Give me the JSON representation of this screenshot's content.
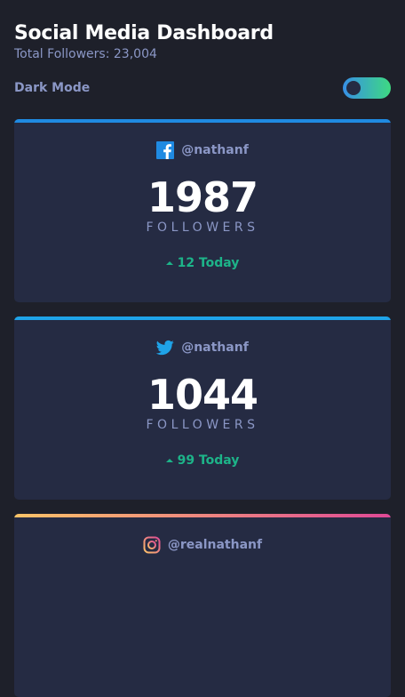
{
  "header": {
    "title": "Social Media Dashboard",
    "subtitle": "Total Followers: 23,004"
  },
  "theme_toggle": {
    "label": "Dark Mode",
    "enabled": true
  },
  "cards": [
    {
      "platform": "facebook",
      "icon": "facebook-icon",
      "handle": "@nathanf",
      "count": "1987",
      "unit": "FOLLOWERS",
      "delta": "12 Today",
      "accent": "#1f8ae2"
    },
    {
      "platform": "twitter",
      "icon": "twitter-icon",
      "handle": "@nathanf",
      "count": "1044",
      "unit": "FOLLOWERS",
      "delta": "99 Today",
      "accent": "#1fa3e8"
    },
    {
      "platform": "instagram",
      "icon": "instagram-icon",
      "handle": "@realnathanf",
      "accent": "#fdc468"
    }
  ],
  "colors": {
    "background": "#1e202a",
    "card": "#252b43",
    "text_muted": "#8b97c6",
    "positive": "#1db489"
  }
}
